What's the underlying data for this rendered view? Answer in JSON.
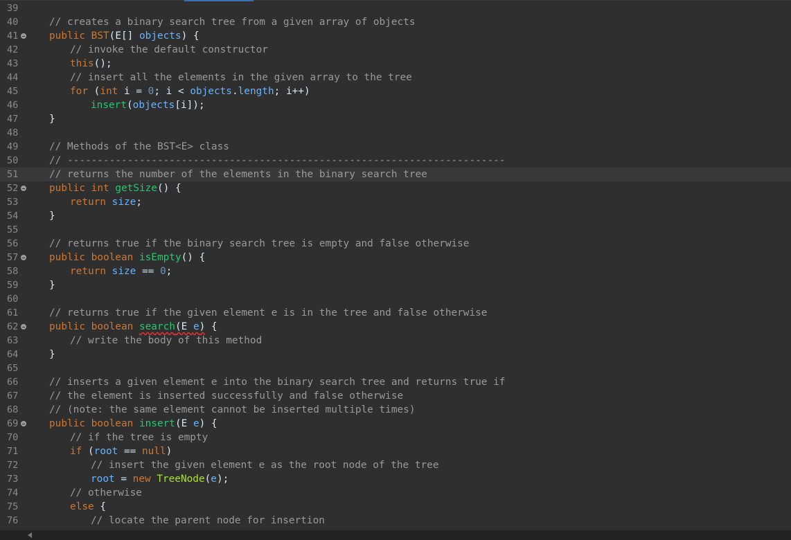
{
  "editor": {
    "current_line": 51,
    "lines": [
      {
        "n": "39",
        "fold": false,
        "indent": 0,
        "tokens": []
      },
      {
        "n": "40",
        "fold": false,
        "indent": 0,
        "tokens": [
          {
            "t": "// creates a binary search tree from a given array of objects",
            "c": "c"
          }
        ]
      },
      {
        "n": "41",
        "fold": true,
        "indent": 0,
        "tokens": [
          {
            "t": "public ",
            "c": "k"
          },
          {
            "t": "BST",
            "c": "n"
          },
          {
            "t": "(E[] ",
            "c": "p"
          },
          {
            "t": "objects",
            "c": "v"
          },
          {
            "t": ") {",
            "c": "p"
          }
        ]
      },
      {
        "n": "42",
        "fold": false,
        "indent": 1,
        "tokens": [
          {
            "t": "// invoke the default constructor",
            "c": "c"
          }
        ]
      },
      {
        "n": "43",
        "fold": false,
        "indent": 1,
        "tokens": [
          {
            "t": "this",
            "c": "k"
          },
          {
            "t": "();",
            "c": "p"
          }
        ]
      },
      {
        "n": "44",
        "fold": false,
        "indent": 1,
        "tokens": [
          {
            "t": "// insert all the elements in the given array to the tree",
            "c": "c"
          }
        ]
      },
      {
        "n": "45",
        "fold": false,
        "indent": 1,
        "tokens": [
          {
            "t": "for",
            "c": "k"
          },
          {
            "t": " (",
            "c": "p"
          },
          {
            "t": "int",
            "c": "k"
          },
          {
            "t": " i = ",
            "c": "p"
          },
          {
            "t": "0",
            "c": "d"
          },
          {
            "t": "; i < ",
            "c": "p"
          },
          {
            "t": "objects",
            "c": "v"
          },
          {
            "t": ".",
            "c": "p"
          },
          {
            "t": "length",
            "c": "v"
          },
          {
            "t": "; i++)",
            "c": "p"
          }
        ]
      },
      {
        "n": "46",
        "fold": false,
        "indent": 2,
        "tokens": [
          {
            "t": "insert",
            "c": "m"
          },
          {
            "t": "(",
            "c": "p"
          },
          {
            "t": "objects",
            "c": "v"
          },
          {
            "t": "[i]);",
            "c": "p"
          }
        ]
      },
      {
        "n": "47",
        "fold": false,
        "indent": 0,
        "tokens": [
          {
            "t": "}",
            "c": "p"
          }
        ]
      },
      {
        "n": "48",
        "fold": false,
        "indent": 0,
        "tokens": []
      },
      {
        "n": "49",
        "fold": false,
        "indent": 0,
        "tokens": [
          {
            "t": "// Methods of the BST<E> class",
            "c": "c"
          }
        ]
      },
      {
        "n": "50",
        "fold": false,
        "indent": 0,
        "tokens": [
          {
            "t": "// -------------------------------------------------------------------------",
            "c": "c"
          }
        ]
      },
      {
        "n": "51",
        "fold": false,
        "indent": 0,
        "tokens": [
          {
            "t": "// returns the number of the elements in the binary search tree",
            "c": "c"
          }
        ]
      },
      {
        "n": "52",
        "fold": true,
        "indent": 0,
        "tokens": [
          {
            "t": "public ",
            "c": "k"
          },
          {
            "t": "int ",
            "c": "k"
          },
          {
            "t": "getSize",
            "c": "m"
          },
          {
            "t": "() {",
            "c": "p"
          }
        ]
      },
      {
        "n": "53",
        "fold": false,
        "indent": 1,
        "tokens": [
          {
            "t": "return ",
            "c": "k"
          },
          {
            "t": "size",
            "c": "v"
          },
          {
            "t": ";",
            "c": "p"
          }
        ]
      },
      {
        "n": "54",
        "fold": false,
        "indent": 0,
        "tokens": [
          {
            "t": "}",
            "c": "p"
          }
        ]
      },
      {
        "n": "55",
        "fold": false,
        "indent": 0,
        "tokens": []
      },
      {
        "n": "56",
        "fold": false,
        "indent": 0,
        "tokens": [
          {
            "t": "// returns true if the binary search tree is empty and false otherwise",
            "c": "c"
          }
        ]
      },
      {
        "n": "57",
        "fold": true,
        "indent": 0,
        "tokens": [
          {
            "t": "public ",
            "c": "k"
          },
          {
            "t": "boolean ",
            "c": "k"
          },
          {
            "t": "isEmpty",
            "c": "m"
          },
          {
            "t": "() {",
            "c": "p"
          }
        ]
      },
      {
        "n": "58",
        "fold": false,
        "indent": 1,
        "tokens": [
          {
            "t": "return ",
            "c": "k"
          },
          {
            "t": "size",
            "c": "v"
          },
          {
            "t": " == ",
            "c": "p"
          },
          {
            "t": "0",
            "c": "d"
          },
          {
            "t": ";",
            "c": "p"
          }
        ]
      },
      {
        "n": "59",
        "fold": false,
        "indent": 0,
        "tokens": [
          {
            "t": "}",
            "c": "p"
          }
        ]
      },
      {
        "n": "60",
        "fold": false,
        "indent": 0,
        "tokens": []
      },
      {
        "n": "61",
        "fold": false,
        "indent": 0,
        "tokens": [
          {
            "t": "// returns true if the given element e is in the tree and false otherwise",
            "c": "c"
          }
        ]
      },
      {
        "n": "62",
        "fold": true,
        "indent": 0,
        "tokens": [
          {
            "t": "public ",
            "c": "k"
          },
          {
            "t": "boolean ",
            "c": "k"
          },
          {
            "t": "search",
            "c": "m",
            "err": true
          },
          {
            "t": "(E ",
            "c": "p",
            "err": true
          },
          {
            "t": "e",
            "c": "v",
            "err": true
          },
          {
            "t": ")",
            "c": "p",
            "err": true
          },
          {
            "t": " {",
            "c": "p"
          }
        ]
      },
      {
        "n": "63",
        "fold": false,
        "indent": 1,
        "tokens": [
          {
            "t": "// write the body of this method",
            "c": "c"
          }
        ]
      },
      {
        "n": "64",
        "fold": false,
        "indent": 0,
        "tokens": [
          {
            "t": "}",
            "c": "p"
          }
        ]
      },
      {
        "n": "65",
        "fold": false,
        "indent": 0,
        "tokens": []
      },
      {
        "n": "66",
        "fold": false,
        "indent": 0,
        "tokens": [
          {
            "t": "// inserts a given element e into the binary search tree and returns true if",
            "c": "c"
          }
        ]
      },
      {
        "n": "67",
        "fold": false,
        "indent": 0,
        "tokens": [
          {
            "t": "// the element is inserted successfully and false otherwise",
            "c": "c"
          }
        ]
      },
      {
        "n": "68",
        "fold": false,
        "indent": 0,
        "tokens": [
          {
            "t": "// (note: the same element cannot be inserted multiple times)",
            "c": "c"
          }
        ]
      },
      {
        "n": "69",
        "fold": true,
        "indent": 0,
        "tokens": [
          {
            "t": "public ",
            "c": "k"
          },
          {
            "t": "boolean ",
            "c": "k"
          },
          {
            "t": "insert",
            "c": "m"
          },
          {
            "t": "(E ",
            "c": "p"
          },
          {
            "t": "e",
            "c": "v"
          },
          {
            "t": ") {",
            "c": "p"
          }
        ]
      },
      {
        "n": "70",
        "fold": false,
        "indent": 1,
        "tokens": [
          {
            "t": "// if the tree is empty",
            "c": "c"
          }
        ]
      },
      {
        "n": "71",
        "fold": false,
        "indent": 1,
        "tokens": [
          {
            "t": "if",
            "c": "k"
          },
          {
            "t": " (",
            "c": "p"
          },
          {
            "t": "root",
            "c": "v"
          },
          {
            "t": " == ",
            "c": "p"
          },
          {
            "t": "null",
            "c": "k"
          },
          {
            "t": ")",
            "c": "p"
          }
        ]
      },
      {
        "n": "72",
        "fold": false,
        "indent": 2,
        "tokens": [
          {
            "t": "// insert the given element e as the root node of the tree",
            "c": "c"
          }
        ]
      },
      {
        "n": "73",
        "fold": false,
        "indent": 2,
        "tokens": [
          {
            "t": "root",
            "c": "v"
          },
          {
            "t": " = ",
            "c": "p"
          },
          {
            "t": "new ",
            "c": "k"
          },
          {
            "t": "TreeNode",
            "c": "cls"
          },
          {
            "t": "(",
            "c": "p"
          },
          {
            "t": "e",
            "c": "v"
          },
          {
            "t": ");",
            "c": "p"
          }
        ]
      },
      {
        "n": "74",
        "fold": false,
        "indent": 1,
        "tokens": [
          {
            "t": "// otherwise",
            "c": "c"
          }
        ]
      },
      {
        "n": "75",
        "fold": false,
        "indent": 1,
        "tokens": [
          {
            "t": "else",
            "c": "k"
          },
          {
            "t": " {",
            "c": "p"
          }
        ]
      },
      {
        "n": "76",
        "fold": false,
        "indent": 2,
        "tokens": [
          {
            "t": "// locate the parent node for insertion",
            "c": "c"
          }
        ]
      }
    ]
  },
  "scrollbar": {
    "left_arrow_icon": "arrow-left-icon"
  }
}
